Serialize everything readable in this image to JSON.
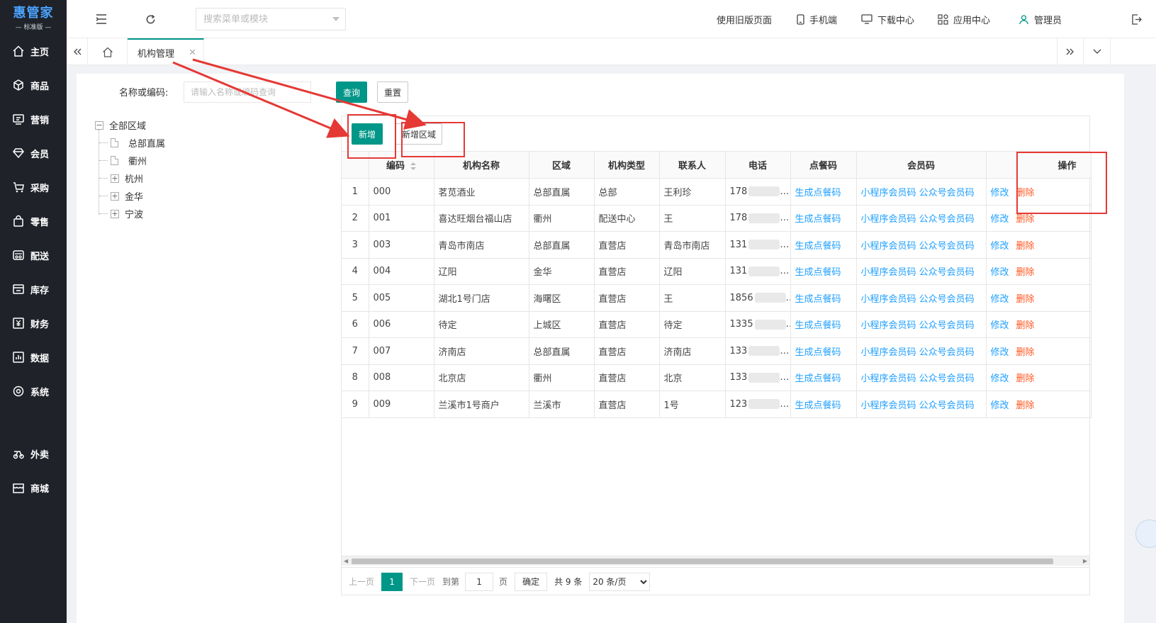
{
  "brand": {
    "name": "惠管家",
    "edition": "标准版"
  },
  "sidebar": {
    "items": [
      {
        "label": "主页",
        "icon": "home-icon"
      },
      {
        "label": "商品",
        "icon": "box-icon"
      },
      {
        "label": "营销",
        "icon": "chat-icon"
      },
      {
        "label": "会员",
        "icon": "diamond-icon"
      },
      {
        "label": "采购",
        "icon": "cart-icon"
      },
      {
        "label": "零售",
        "icon": "bag-icon"
      },
      {
        "label": "配送",
        "icon": "truck-icon"
      },
      {
        "label": "库存",
        "icon": "store-icon"
      },
      {
        "label": "财务",
        "icon": "money-icon"
      },
      {
        "label": "数据",
        "icon": "chart-icon"
      },
      {
        "label": "系统",
        "icon": "settings-icon"
      }
    ],
    "extra_items": [
      {
        "label": "外卖",
        "icon": "takeaway-icon"
      },
      {
        "label": "商城",
        "icon": "mall-icon"
      }
    ]
  },
  "topbar": {
    "search_placeholder": "搜索菜单或模块",
    "old_version": "使用旧版页面",
    "mobile": "手机端",
    "download": "下载中心",
    "apps": "应用中心",
    "user": "管理员"
  },
  "tabs": {
    "active": "机构管理"
  },
  "filter": {
    "label": "名称或编码:",
    "placeholder": "请输入名称或编码查询",
    "query": "查询",
    "reset": "重置"
  },
  "tree": {
    "root": "全部区域",
    "children": [
      {
        "label": "总部直属",
        "type": "leaf"
      },
      {
        "label": "衢州",
        "type": "leaf"
      },
      {
        "label": "杭州",
        "type": "folder"
      },
      {
        "label": "金华",
        "type": "folder"
      },
      {
        "label": "宁波",
        "type": "folder"
      }
    ]
  },
  "toolbar": {
    "add": "新增",
    "add_region": "新增区域"
  },
  "table": {
    "headers": [
      "",
      "编码",
      "机构名称",
      "区域",
      "机构类型",
      "联系人",
      "电话",
      "点餐码",
      "会员码",
      "操作"
    ],
    "rows": [
      {
        "n": "1",
        "code": "000",
        "name": "茗苋酒业",
        "region": "总部直属",
        "type": "总部",
        "contact": "王利珍",
        "phone": "178"
      },
      {
        "n": "2",
        "code": "001",
        "name": "喜达旺烟台福山店",
        "region": "衢州",
        "type": "配送中心",
        "contact": "王",
        "phone": "178"
      },
      {
        "n": "3",
        "code": "003",
        "name": "青岛市南店",
        "region": "总部直属",
        "type": "直营店",
        "contact": "青岛市南店",
        "phone": "131"
      },
      {
        "n": "4",
        "code": "004",
        "name": "辽阳",
        "region": "金华",
        "type": "直营店",
        "contact": "辽阳",
        "phone": "131"
      },
      {
        "n": "5",
        "code": "005",
        "name": "湖北1号门店",
        "region": "海曙区",
        "type": "直营店",
        "contact": "王",
        "phone": "1856"
      },
      {
        "n": "6",
        "code": "006",
        "name": "待定",
        "region": "上城区",
        "type": "直营店",
        "contact": "待定",
        "phone": "1335"
      },
      {
        "n": "7",
        "code": "007",
        "name": "济南店",
        "region": "总部直属",
        "type": "直营店",
        "contact": "济南店",
        "phone": "133"
      },
      {
        "n": "8",
        "code": "008",
        "name": "北京店",
        "region": "衢州",
        "type": "直营店",
        "contact": "北京",
        "phone": "133"
      },
      {
        "n": "9",
        "code": "009",
        "name": "兰溪市1号商户",
        "region": "兰溪市",
        "type": "直营店",
        "contact": "1号",
        "phone": "123"
      }
    ],
    "gen_order_code": "生成点餐码",
    "mini_member_code": "小程序会员码",
    "official_member_code": "公众号会员码",
    "edit": "修改",
    "delete": "删除"
  },
  "pager": {
    "prev": "上一页",
    "current": "1",
    "next": "下一页",
    "goto": "到第",
    "page_value": "1",
    "page_unit": "页",
    "confirm": "确定",
    "total": "共 9 条",
    "page_size": "20 条/页"
  },
  "colors": {
    "sidebar_bg": "#1f2329",
    "primary": "#009688",
    "link_blue": "#1e9fff",
    "link_red": "#ff5722",
    "annotation_red": "#e53935"
  }
}
